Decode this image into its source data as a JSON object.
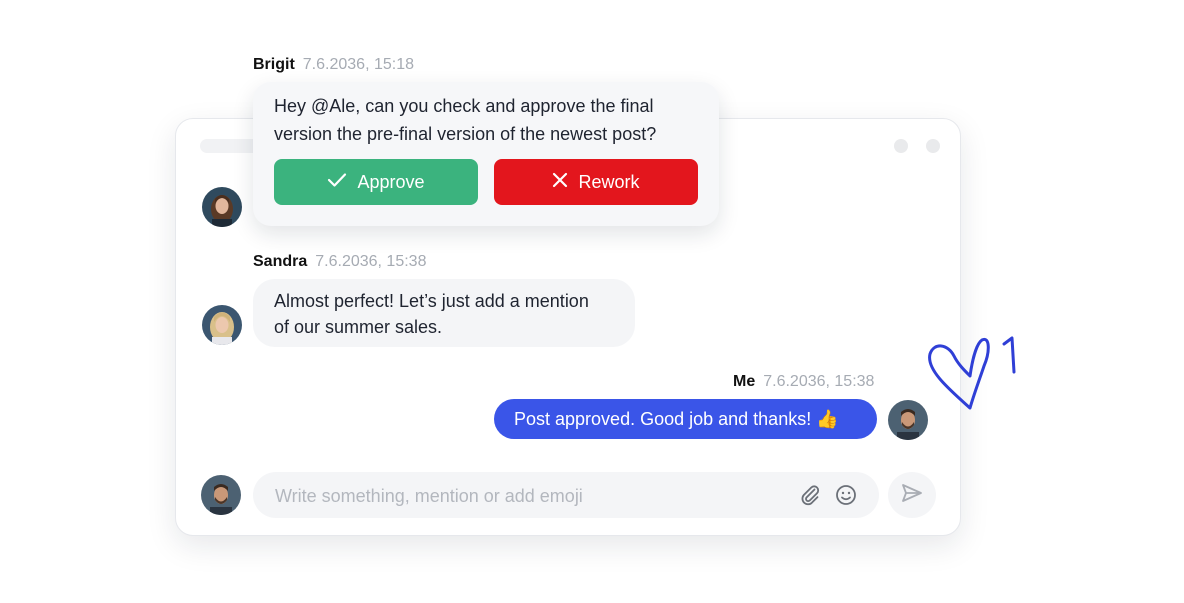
{
  "messages": [
    {
      "author": "Brigit",
      "time": "7.6.2036, 15:18",
      "text": "Hey @Ale, can you check and approve the final version the pre-final version of the newest post?",
      "actions": {
        "approve_label": "Approve",
        "rework_label": "Rework"
      }
    },
    {
      "author": "Sandra",
      "time": "7.6.2036, 15:38",
      "text_line1": "Almost perfect! Let’s just add a mention",
      "text_line2": "of our summer sales."
    },
    {
      "author": "Me",
      "time": "7.6.2036, 15:38",
      "text": "Post approved. Good job and thanks! 👍"
    }
  ],
  "composer": {
    "placeholder": "Write something, mention or add emoji"
  },
  "colors": {
    "approve": "#3bb37e",
    "rework": "#e3161d",
    "my_bubble": "#3a55e8",
    "doodle": "#2f3fd6"
  },
  "icons": [
    "check-icon",
    "close-icon",
    "paperclip-icon",
    "emoji-icon",
    "send-icon",
    "heart-doodle"
  ]
}
